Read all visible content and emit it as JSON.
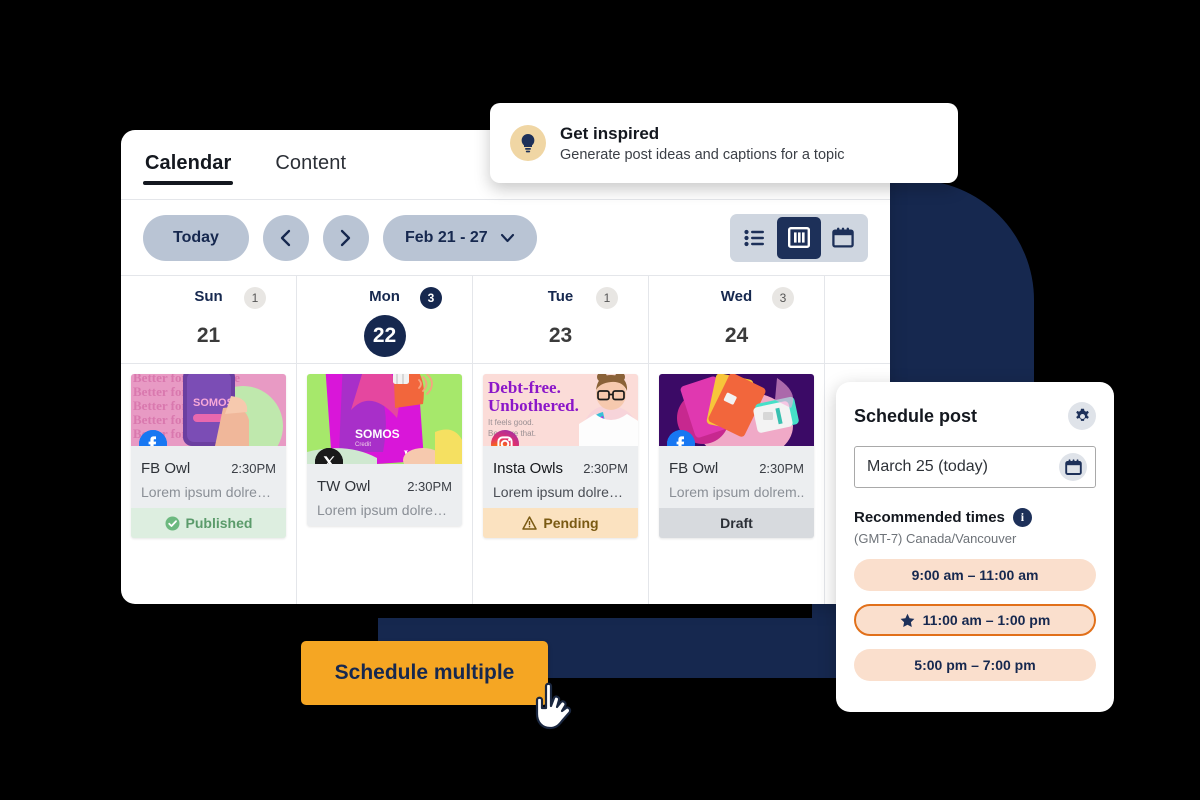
{
  "app": {
    "tabs": [
      {
        "label": "Calendar",
        "active": true
      },
      {
        "label": "Content",
        "active": false
      }
    ],
    "toolbar": {
      "today_label": "Today",
      "prev_icon": "chevron-left-icon",
      "next_icon": "chevron-right-icon",
      "range_label": "Feb 21 - 27",
      "range_chevron": "chevron-down-icon",
      "views": [
        {
          "name": "list-view",
          "active": false
        },
        {
          "name": "column-view",
          "active": true
        },
        {
          "name": "calendar-view",
          "active": false
        }
      ]
    },
    "days": [
      {
        "name": "Sun",
        "num": "21",
        "count": "1",
        "today": false,
        "count_highlight": false
      },
      {
        "name": "Mon",
        "num": "22",
        "count": "3",
        "today": true,
        "count_highlight": true
      },
      {
        "name": "Tue",
        "num": "23",
        "count": "1",
        "today": false,
        "count_highlight": false
      },
      {
        "name": "Wed",
        "num": "24",
        "count": "3",
        "today": false,
        "count_highlight": false
      }
    ],
    "posts": [
      {
        "account": "FB Owl",
        "time": "2:30PM",
        "text": "Lorem ipsum dolre…",
        "status": "Published",
        "status_type": "published",
        "status_icon": "check-circle-icon",
        "network": "facebook-icon",
        "thumb_text": "Better for everyone",
        "thumb_brand": "SOMOS"
      },
      {
        "account": "TW Owl",
        "time": "2:30PM",
        "text": "Lorem ipsum dolre…",
        "status": "",
        "status_type": "none",
        "status_icon": "",
        "network": "x-twitter-icon",
        "thumb_text": "",
        "thumb_brand": "SOMOS"
      },
      {
        "account": "Insta Owls",
        "time": "2:30PM",
        "text": "Lorem ipsum dolre…",
        "status": "Pending",
        "status_type": "pending",
        "status_icon": "warning-triangle-icon",
        "network": "instagram-icon",
        "thumb_text": "Debt-free. Unbothered.",
        "thumb_sub": "It feels good. Be more that."
      },
      {
        "account": "FB Owl",
        "time": "2:30PM",
        "text": "Lorem ipsum dolrem..",
        "status": "Draft",
        "status_type": "draft",
        "status_icon": "",
        "network": "facebook-icon",
        "thumb_text": "",
        "thumb_brand": ""
      }
    ]
  },
  "toast": {
    "icon": "lightbulb-icon",
    "title": "Get inspired",
    "subtitle": "Generate post ideas and captions for a topic"
  },
  "schedule": {
    "title": "Schedule post",
    "gear_icon": "gear-icon",
    "date_value": "March 25 (today)",
    "date_icon": "calendar-icon",
    "recommended_label": "Recommended times",
    "info_icon": "info-icon",
    "timezone": "(GMT-7) Canada/Vancouver",
    "times": [
      {
        "label": "9:00 am – 11:00 am",
        "selected": false,
        "icon": ""
      },
      {
        "label": "11:00 am – 1:00 pm",
        "selected": true,
        "icon": "star-icon"
      },
      {
        "label": "5:00 pm – 7:00 pm",
        "selected": false,
        "icon": ""
      }
    ]
  },
  "cta": {
    "label": "Schedule multiple",
    "cursor_icon": "pointing-hand-cursor-icon"
  },
  "colors": {
    "navy": "#16284f",
    "orange": "#f5a623",
    "accent_orange": "#e1701a",
    "pill_gray": "#b9c4d4",
    "peach": "#fadfcd"
  }
}
